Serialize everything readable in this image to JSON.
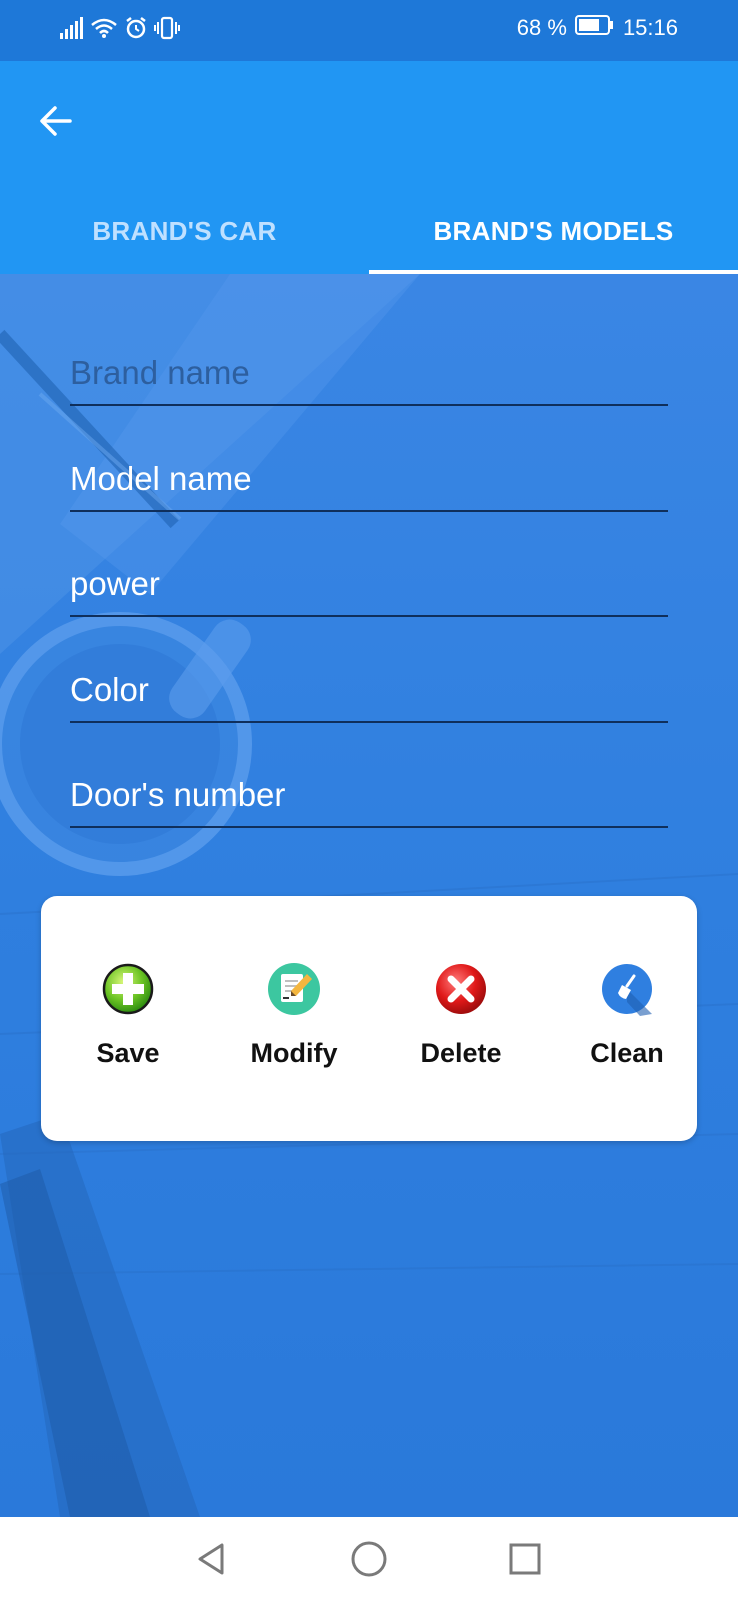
{
  "status_bar": {
    "battery": "68 %",
    "time": "15:16",
    "icons": [
      "signal-icon",
      "wifi-icon",
      "alarm-icon",
      "vibrate-icon",
      "battery-icon"
    ]
  },
  "app_bar": {
    "back_icon": "arrow-left-icon",
    "tabs": [
      {
        "label": "BRAND'S CAR",
        "active": false
      },
      {
        "label": "BRAND'S MODELS",
        "active": true
      }
    ]
  },
  "form": {
    "brand_name": {
      "placeholder": "Brand name",
      "value": ""
    },
    "model_name": {
      "placeholder": "Model name",
      "value": ""
    },
    "power": {
      "placeholder": "power",
      "value": ""
    },
    "color": {
      "placeholder": "Color",
      "value": ""
    },
    "doors": {
      "placeholder": "Door's number",
      "value": ""
    }
  },
  "actions": {
    "save": "Save",
    "modify": "Modify",
    "delete": "Delete",
    "clean": "Clean"
  },
  "nav_bar": {
    "icons": [
      "back-triangle-icon",
      "home-circle-icon",
      "recents-square-icon"
    ]
  },
  "colors": {
    "status_bar": "#1e78d8",
    "app_bar": "#2196f3",
    "background": "#2f7fe0",
    "tab_indicator": "#ffffff"
  }
}
